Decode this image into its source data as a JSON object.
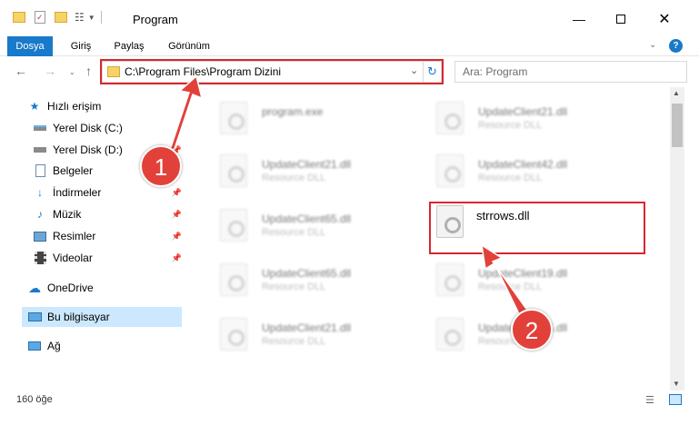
{
  "window": {
    "title": "Program"
  },
  "ribbon": {
    "tabs": [
      "Dosya",
      "Giriş",
      "Paylaş",
      "Görünüm"
    ]
  },
  "address": {
    "path": "C:\\Program Files\\Program Dizini"
  },
  "search": {
    "placeholder": "Ara: Program"
  },
  "sidebar": {
    "items": [
      {
        "label": "Hızlı erişim",
        "icon": "star-icon"
      },
      {
        "label": "Yerel Disk (C:)",
        "icon": "drive-icon"
      },
      {
        "label": "Yerel Disk (D:)",
        "icon": "drive-icon"
      },
      {
        "label": "Belgeler",
        "icon": "documents-icon"
      },
      {
        "label": "İndirmeler",
        "icon": "download-icon"
      },
      {
        "label": "Müzik",
        "icon": "music-icon"
      },
      {
        "label": "Resimler",
        "icon": "pictures-icon"
      },
      {
        "label": "Videolar",
        "icon": "video-icon"
      },
      {
        "label": "OneDrive",
        "icon": "cloud-icon"
      },
      {
        "label": "Bu bilgisayar",
        "icon": "computer-icon"
      },
      {
        "label": "Ağ",
        "icon": "network-icon"
      }
    ]
  },
  "files": [
    {
      "name": "program.exe",
      "type": ""
    },
    {
      "name": "UpdateClient21.dll",
      "type": "Resource DLL"
    },
    {
      "name": "UpdateClient21.dll",
      "type": "Resource DLL"
    },
    {
      "name": "UpdateClient42.dll",
      "type": "Resource DLL"
    },
    {
      "name": "UpdateClient65.dll",
      "type": "Resource DLL"
    },
    {
      "name": "strrows.dll",
      "type": ""
    },
    {
      "name": "UpdateClient65.dll",
      "type": "Resource DLL"
    },
    {
      "name": "UpdateClient19.dll",
      "type": "Resource DLL"
    },
    {
      "name": "UpdateClient21.dll",
      "type": "Resource DLL"
    },
    {
      "name": "UpdateClient65.dll",
      "type": "Resource DLL"
    }
  ],
  "annotations": {
    "badge1": "1",
    "badge2": "2"
  },
  "status": {
    "count": "160 öğe"
  },
  "colors": {
    "accent": "#1979ca",
    "highlight": "#d9262e",
    "badge": "#e2413a"
  }
}
